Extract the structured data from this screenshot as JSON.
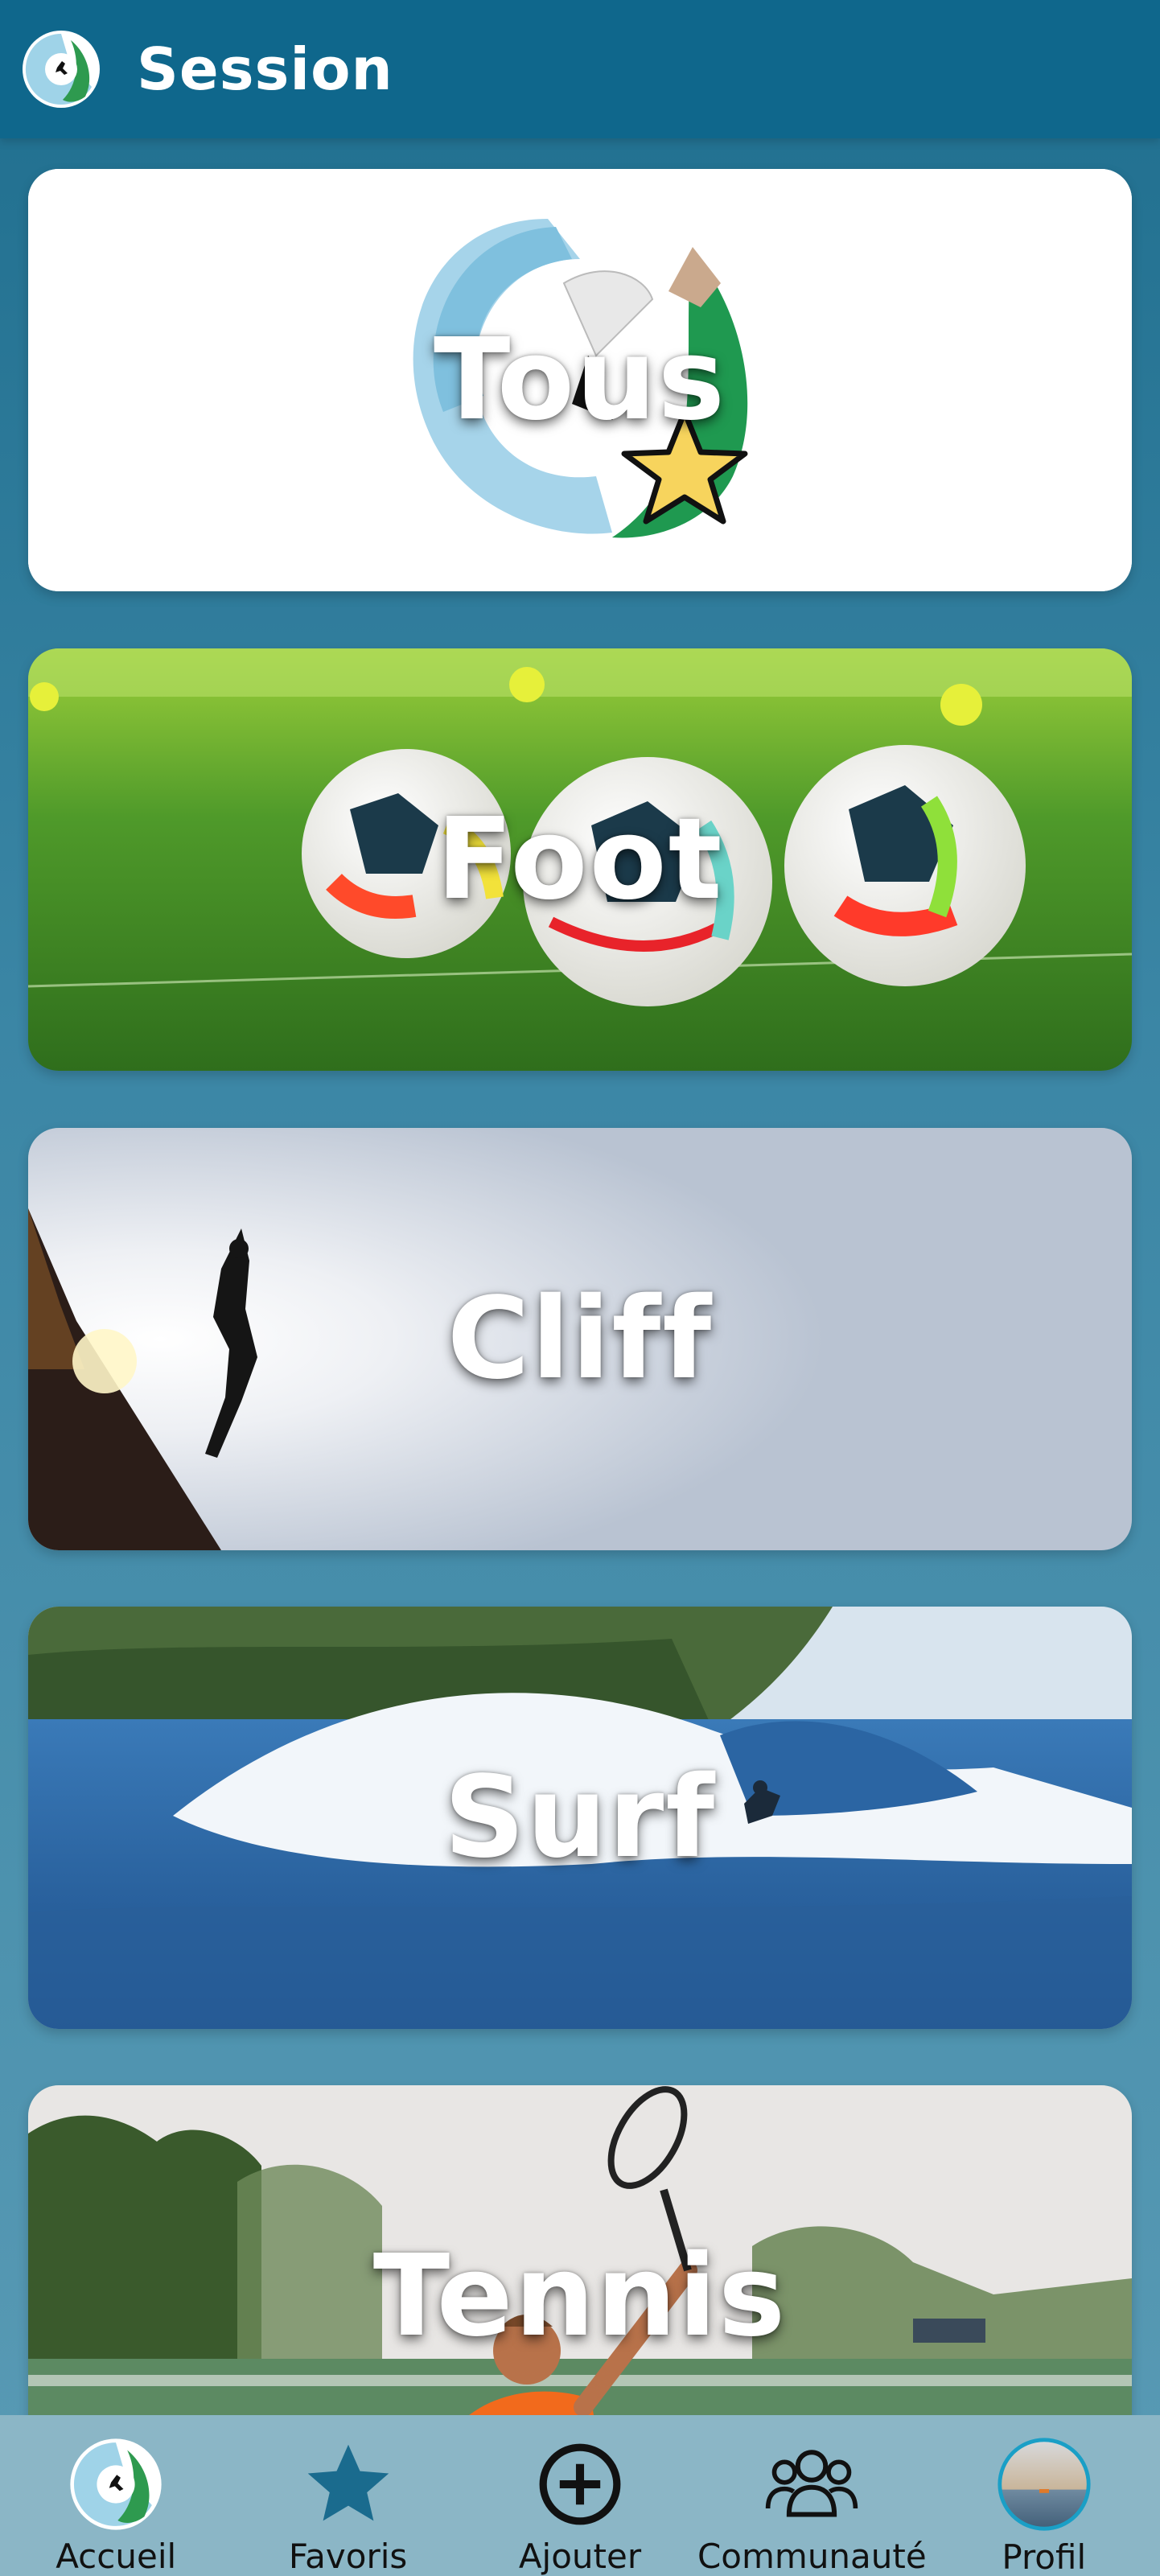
{
  "header": {
    "title": "Session",
    "logo_icon": "app-logo-icon"
  },
  "categories": [
    {
      "label": "Tous",
      "image": "app-logo-star-image"
    },
    {
      "label": "Foot",
      "image": "soccer-balls-photo"
    },
    {
      "label": "Cliff",
      "image": "cliff-diver-photo"
    },
    {
      "label": "Surf",
      "image": "surf-wave-photo"
    },
    {
      "label": "Tennis",
      "image": "tennis-player-photo"
    }
  ],
  "nav": {
    "items": [
      {
        "label": "Accueil",
        "icon": "app-logo-icon"
      },
      {
        "label": "Favoris",
        "icon": "star-icon"
      },
      {
        "label": "Ajouter",
        "icon": "plus-circle-icon"
      },
      {
        "label": "Communauté",
        "icon": "community-icon"
      },
      {
        "label": "Profil",
        "icon": "avatar"
      }
    ]
  },
  "colors": {
    "header": "#0f678c",
    "nav_background": "#8bb6c6",
    "favorite_star": "#1a6b8e",
    "label_text": "#ffffff"
  }
}
